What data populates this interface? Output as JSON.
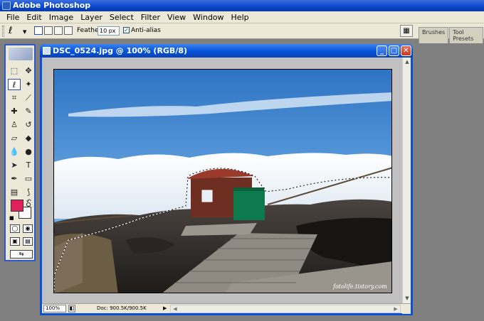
{
  "app": {
    "title": "Adobe Photoshop"
  },
  "menu": {
    "items": [
      "File",
      "Edit",
      "Image",
      "Layer",
      "Select",
      "Filter",
      "View",
      "Window",
      "Help"
    ]
  },
  "options": {
    "tool_icon": "lasso-icon",
    "feather_label": "Feather:",
    "feather_value": "10 px",
    "antialias_label": "Anti-alias",
    "antialias_checked": true,
    "well_tabs": [
      "Brushes",
      "Tool Presets"
    ]
  },
  "toolbox": {
    "tools": [
      {
        "name": "rectangular-marquee-icon",
        "glyph": "⬚",
        "active": false
      },
      {
        "name": "move-icon",
        "glyph": "✥",
        "active": false
      },
      {
        "name": "lasso-icon",
        "glyph": "ℓ",
        "active": true
      },
      {
        "name": "magic-wand-icon",
        "glyph": "✦",
        "active": false
      },
      {
        "name": "crop-icon",
        "glyph": "⌗",
        "active": false
      },
      {
        "name": "slice-icon",
        "glyph": "⟋",
        "active": false
      },
      {
        "name": "healing-brush-icon",
        "glyph": "✚",
        "active": false
      },
      {
        "name": "brush-icon",
        "glyph": "✎",
        "active": false
      },
      {
        "name": "clone-stamp-icon",
        "glyph": "♙",
        "active": false
      },
      {
        "name": "history-brush-icon",
        "glyph": "↺",
        "active": false
      },
      {
        "name": "eraser-icon",
        "glyph": "▱",
        "active": false
      },
      {
        "name": "paint-bucket-icon",
        "glyph": "◆",
        "active": false
      },
      {
        "name": "blur-icon",
        "glyph": "💧",
        "active": false
      },
      {
        "name": "dodge-icon",
        "glyph": "●",
        "active": false
      },
      {
        "name": "path-selection-icon",
        "glyph": "➤",
        "active": false
      },
      {
        "name": "type-icon",
        "glyph": "T",
        "active": false
      },
      {
        "name": "pen-icon",
        "glyph": "✒",
        "active": false
      },
      {
        "name": "rectangle-shape-icon",
        "glyph": "▭",
        "active": false
      },
      {
        "name": "notes-icon",
        "glyph": "▤",
        "active": false
      },
      {
        "name": "eyedropper-icon",
        "glyph": "⟆",
        "active": false
      },
      {
        "name": "hand-icon",
        "glyph": "✋",
        "active": false
      },
      {
        "name": "zoom-icon",
        "glyph": "⚲",
        "active": false
      }
    ],
    "foreground_color": "#e0205c",
    "background_color": "#ffffff"
  },
  "document": {
    "title": "DSC_0524.jpg @ 100% (RGB/8)",
    "zoom": "100%",
    "doc_info": "Doc: 900.5K/900.5K",
    "watermark": "fotolife.tistory.com"
  }
}
